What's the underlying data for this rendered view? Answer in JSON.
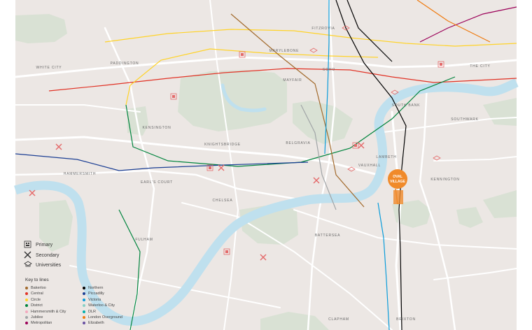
{
  "colors": {
    "land": "#ece7e4",
    "park": "#d9e1d4",
    "river": "#bfe0ee",
    "road": "#ffffff",
    "ring_outer": "#f7f4f1",
    "pin_orange": "#f08a2a",
    "school_red": "#e46a6a",
    "dark_blue": "#2a3a9e"
  },
  "districts": [
    "WHITE CITY",
    "PADDINGTON",
    "MARYLEBONE",
    "FITZROVIA",
    "SOHO",
    "MAYFAIR",
    "KENSINGTON",
    "KNIGHTSBRIDGE",
    "BELGRAVIA",
    "SOUTH BANK",
    "LAMBETH",
    "KENNINGTON",
    "HAMMERSMITH",
    "EARL'S COURT",
    "CHELSEA",
    "FULHAM",
    "BATTERSEA",
    "CLAPHAM",
    "BRIXTON",
    "SOUTHWARK",
    "THE CITY",
    "VAUXHALL"
  ],
  "pin": {
    "line1": "OVAL",
    "line2": "VILLAGE"
  },
  "key": {
    "primary": "Primary",
    "secondary": "Secondary",
    "universities": "Universities",
    "title": "Key to lines"
  },
  "lines": [
    {
      "name": "Bakerloo",
      "color": "#a26a2c"
    },
    {
      "name": "Central",
      "color": "#e13225"
    },
    {
      "name": "Circle",
      "color": "#ffd329"
    },
    {
      "name": "District",
      "color": "#00843d"
    },
    {
      "name": "Hammersmith & City",
      "color": "#f4a9be"
    },
    {
      "name": "Jubilee",
      "color": "#a1a5a7"
    },
    {
      "name": "Metropolitan",
      "color": "#9b0058"
    },
    {
      "name": "Northern",
      "color": "#000000"
    },
    {
      "name": "Piccadilly",
      "color": "#1c3f94"
    },
    {
      "name": "Victoria",
      "color": "#0a9cda"
    },
    {
      "name": "Waterloo & City",
      "color": "#88d0c4"
    },
    {
      "name": "DLR",
      "color": "#00afad"
    },
    {
      "name": "London Overground",
      "color": "#ef7b10"
    },
    {
      "name": "Elizabeth",
      "color": "#6950a1"
    }
  ]
}
